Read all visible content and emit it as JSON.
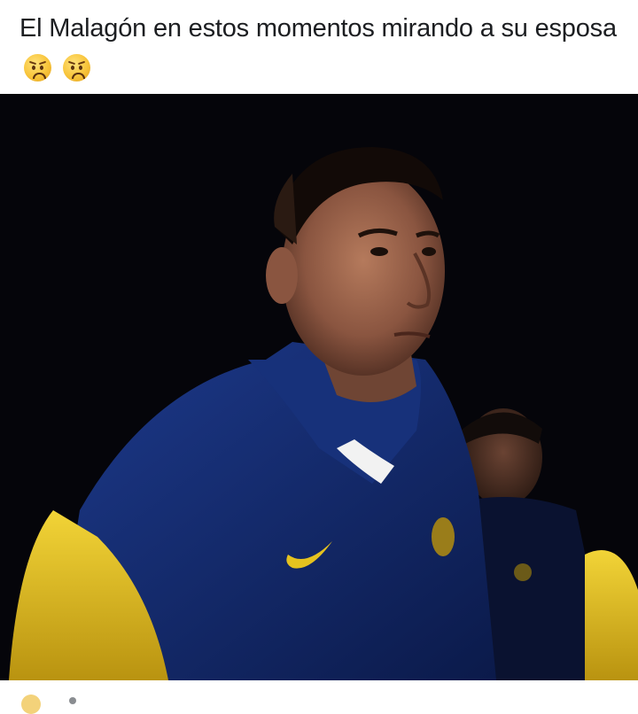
{
  "post": {
    "caption_text": "El Malagón en estos momentos mirando a su esposa",
    "caption_emojis": [
      "frowning-face-emoji",
      "frowning-face-emoji"
    ]
  },
  "colors": {
    "background": "#ffffff",
    "caption_text": "#1c1e21",
    "photo_background": "#05050a",
    "jacket_navy": "#142a6e",
    "jacket_yellow": "#e5c21f"
  }
}
